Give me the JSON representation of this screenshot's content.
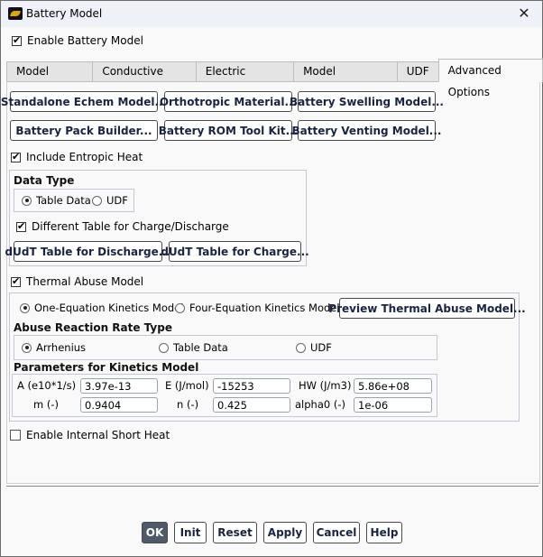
{
  "window": {
    "title": "Battery Model",
    "icon": "battery-app-icon",
    "close_icon": "close-icon"
  },
  "enable_battery_model": {
    "label": "Enable Battery Model",
    "checked": true
  },
  "tabs": [
    {
      "label": "Model Options",
      "active": false
    },
    {
      "label": "Conductive Zones",
      "active": false
    },
    {
      "label": "Electric Contacts",
      "active": false
    },
    {
      "label": "Model Parameters",
      "active": false
    },
    {
      "label": "UDF",
      "active": false
    },
    {
      "label": "Advanced Options",
      "active": true
    }
  ],
  "advanced": {
    "buttons": [
      {
        "label": "Standalone Echem Model..."
      },
      {
        "label": "Orthotropic Material..."
      },
      {
        "label": "Battery Swelling Model..."
      },
      {
        "label": "Battery Pack Builder..."
      },
      {
        "label": "Battery ROM Tool Kit..."
      },
      {
        "label": "Battery Venting Model..."
      }
    ],
    "include_entropic_heat": {
      "label": "Include Entropic Heat",
      "checked": true
    },
    "data_type": {
      "title": "Data Type",
      "options": [
        {
          "label": "Table Data",
          "selected": true
        },
        {
          "label": "UDF",
          "selected": false
        }
      ],
      "different_table": {
        "label": "Different Table for Charge/Discharge",
        "checked": true
      },
      "discharge_button": "dUdT Table for Discharge...",
      "charge_button": "dUdT Table for Charge..."
    },
    "thermal_abuse": {
      "label": "Thermal Abuse Model",
      "checked": true,
      "kinetics_options": [
        {
          "label": "One-Equation Kinetics Model",
          "selected": true
        },
        {
          "label": "Four-Equation Kinetics Model",
          "selected": false
        }
      ],
      "preview_button": "Preview Thermal Abuse Model...",
      "rate_type": {
        "title": "Abuse Reaction Rate Type",
        "options": [
          {
            "label": "Arrhenius",
            "selected": true
          },
          {
            "label": "Table Data",
            "selected": false
          },
          {
            "label": "UDF",
            "selected": false
          }
        ]
      },
      "parameters": {
        "title": "Parameters for Kinetics Model",
        "fields": [
          {
            "label": "A (e10*1/s)",
            "value": "3.97e-13"
          },
          {
            "label": "E (J/mol)",
            "value": "-15253"
          },
          {
            "label": "HW (J/m3)",
            "value": "5.86e+08"
          },
          {
            "label": "m (-)",
            "value": "0.9404"
          },
          {
            "label": "n (-)",
            "value": "0.425"
          },
          {
            "label": "alpha0 (-)",
            "value": "1e-06"
          }
        ]
      }
    },
    "internal_short_heat": {
      "label": "Enable Internal Short Heat",
      "checked": false
    }
  },
  "footer": {
    "ok": "OK",
    "init": "Init",
    "reset": "Reset",
    "apply": "Apply",
    "cancel": "Cancel",
    "help": "Help"
  }
}
